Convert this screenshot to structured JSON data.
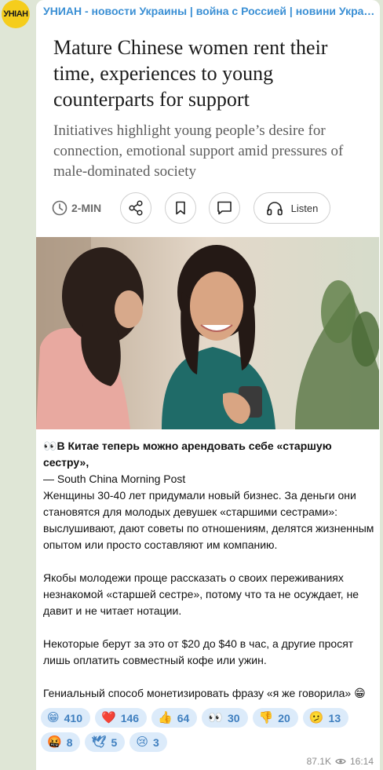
{
  "channel": {
    "avatar_text": "УНIАН",
    "name": "УНИАН - новости Украины | война с Россией | новини України..."
  },
  "link_preview": {
    "title": "Mature Chinese women rent their time, experiences to young counterparts for support",
    "subtitle": "Initiatives highlight young people’s desire for connection, emotional support amid pressures of male-dominated society",
    "read_time": "2-MIN",
    "listen_label": "Listen",
    "icons": [
      "clock-icon",
      "share-icon",
      "bookmark-icon",
      "comment-icon",
      "headphones-icon"
    ]
  },
  "post": {
    "headline_emoji": "👀",
    "headline": "В Китае теперь можно арендовать себе «старшую сестру»,",
    "source": "— South China Morning Post",
    "paragraph1": "Женщины 30-40 лет придумали новый бизнес. За деньги они становятся для молодых девушек «старшими сестрами»: выслушивают, дают советы по отношениям, делятся жизненным опытом или просто составляют им компанию.",
    "paragraph2": "Якобы молодежи проще рассказать о своих переживаниях незнакомой «старшей сестре», потому что та не осуждает, не давит и не читает нотации.",
    "paragraph3": "Некоторые берут за это от $20 до $40 в час, а другие просят лишь оплатить совместный кофе или ужин.",
    "paragraph4": "Гениальный способ монетизировать фразу «я же говорила» 😁"
  },
  "reactions": [
    {
      "emoji": "😁",
      "count": "410"
    },
    {
      "emoji": "❤️",
      "count": "146"
    },
    {
      "emoji": "👍",
      "count": "64"
    },
    {
      "emoji": "👀",
      "count": "30"
    },
    {
      "emoji": "👎",
      "count": "20"
    },
    {
      "emoji": "🫤",
      "count": "13"
    },
    {
      "emoji": "🤬",
      "count": "8"
    },
    {
      "emoji": "🕊",
      "count": "5"
    },
    {
      "emoji": "😢",
      "count": "3"
    }
  ],
  "meta": {
    "views": "87.1K",
    "time": "16:14"
  },
  "colors": {
    "background": "#dfe6d6",
    "channel_name": "#3a8fd4",
    "reaction_bg": "#dcebfa",
    "reaction_text": "#3f7fbf",
    "avatar": "#f5cd1c"
  }
}
